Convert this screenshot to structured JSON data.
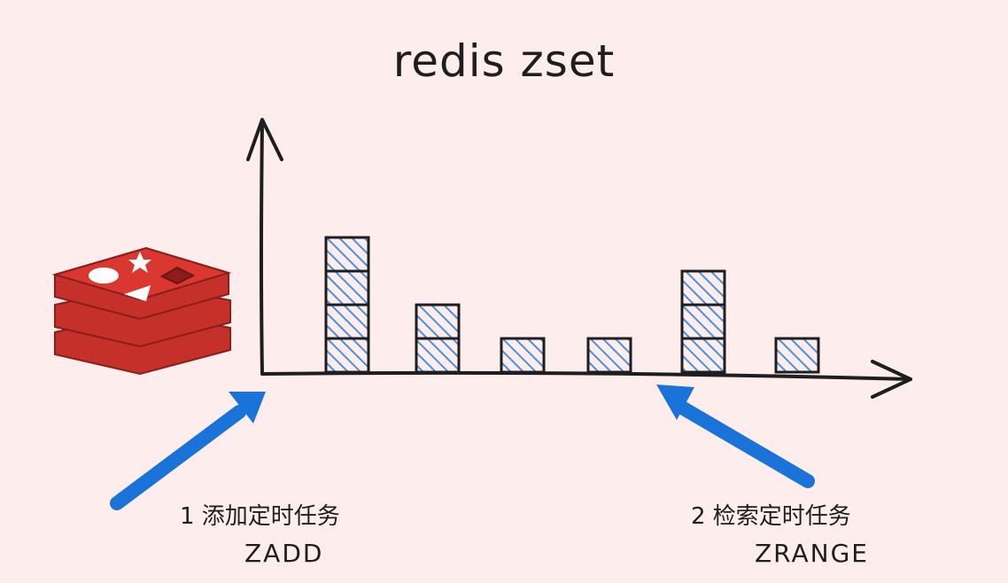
{
  "title": "redis zset",
  "logo": {
    "name": "redis-logo",
    "color": "#c6302b"
  },
  "bars": {
    "stack_heights": [
      4,
      2,
      1,
      1,
      3,
      1
    ],
    "fill": "#4a90e2",
    "stroke": "#1e1e1e"
  },
  "arrows": {
    "color": "#1a73d9"
  },
  "steps": [
    {
      "label": "1  添加定时任务",
      "command": "ZADD"
    },
    {
      "label": "2  检索定时任务",
      "command": "ZRANGE"
    }
  ]
}
